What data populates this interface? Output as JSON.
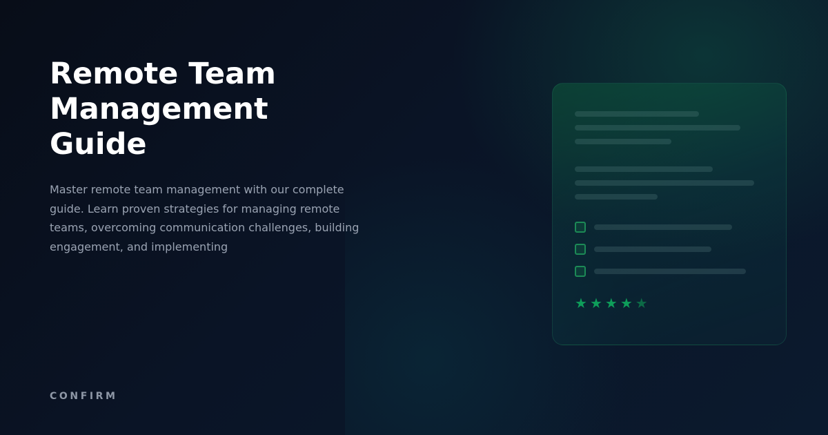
{
  "hero": {
    "title_line1": "Remote Team",
    "title_line2": "Management Guide",
    "description": "Master remote team management with our complete guide. Learn proven strategies for managing remote teams, overcoming communication challenges, building engagement, and implementing"
  },
  "brand": {
    "label": "CONFIRM"
  },
  "illustration": {
    "checklist_count": 3,
    "rating": {
      "filled": 4,
      "total": 5
    },
    "icons": [
      "checkbox-icon",
      "star-icon"
    ]
  },
  "colors": {
    "accent_green": "#0e9e5a",
    "background": "#0a1426",
    "description_text": "#9aa3b2"
  }
}
